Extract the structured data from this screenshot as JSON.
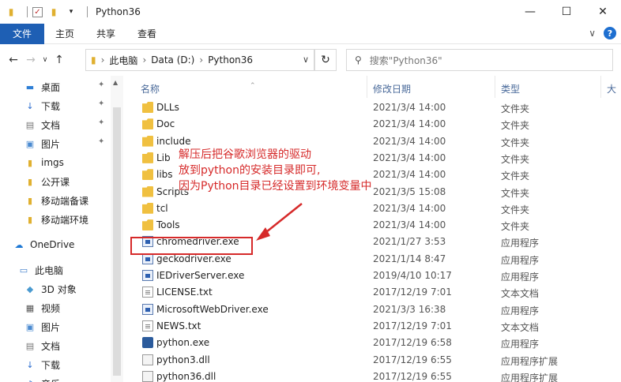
{
  "window": {
    "title": "Python36",
    "minimize_glyph": "—",
    "maximize_glyph": "☐",
    "close_glyph": "✕"
  },
  "ribbon": {
    "tabs": [
      "文件",
      "主页",
      "共享",
      "查看"
    ],
    "expand_glyph": "∨",
    "help_glyph": "?"
  },
  "address": {
    "crumbs": [
      "此电脑",
      "Data (D:)",
      "Python36"
    ],
    "search_placeholder": "搜索\"Python36\""
  },
  "sidebar": {
    "items": [
      {
        "label": "桌面",
        "icon": "desktop-icon",
        "pinned": true
      },
      {
        "label": "下载",
        "icon": "download-icon",
        "pinned": true
      },
      {
        "label": "文档",
        "icon": "document-icon",
        "pinned": true
      },
      {
        "label": "图片",
        "icon": "picture-icon",
        "pinned": true
      },
      {
        "label": "imgs",
        "icon": "folder-icon",
        "pinned": false
      },
      {
        "label": "公开课",
        "icon": "folder-icon",
        "pinned": false
      },
      {
        "label": "移动端备课",
        "icon": "folder-icon",
        "pinned": false
      },
      {
        "label": "移动端环境",
        "icon": "folder-icon",
        "pinned": false
      },
      {
        "label": "OneDrive",
        "icon": "cloud-icon",
        "pinned": false
      },
      {
        "label": "此电脑",
        "icon": "computer-icon",
        "pinned": false
      },
      {
        "label": "3D 对象",
        "icon": "cube-icon",
        "pinned": false
      },
      {
        "label": "视频",
        "icon": "video-icon",
        "pinned": false
      },
      {
        "label": "图片",
        "icon": "picture-icon",
        "pinned": false
      },
      {
        "label": "文档",
        "icon": "document-icon",
        "pinned": false
      },
      {
        "label": "下载",
        "icon": "download-icon",
        "pinned": false
      },
      {
        "label": "音乐",
        "icon": "music-icon",
        "pinned": false
      }
    ]
  },
  "columns": {
    "name": "名称",
    "date": "修改日期",
    "type": "类型",
    "size": "大"
  },
  "files": [
    {
      "name": "DLLs",
      "date": "2021/3/4 14:00",
      "type": "文件夹",
      "kind": "folder"
    },
    {
      "name": "Doc",
      "date": "2021/3/4 14:00",
      "type": "文件夹",
      "kind": "folder"
    },
    {
      "name": "include",
      "date": "2021/3/4 14:00",
      "type": "文件夹",
      "kind": "folder"
    },
    {
      "name": "Lib",
      "date": "2021/3/4 14:00",
      "type": "文件夹",
      "kind": "folder"
    },
    {
      "name": "libs",
      "date": "2021/3/4 14:00",
      "type": "文件夹",
      "kind": "folder"
    },
    {
      "name": "Scripts",
      "date": "2021/3/5 15:08",
      "type": "文件夹",
      "kind": "folder"
    },
    {
      "name": "tcl",
      "date": "2021/3/4 14:00",
      "type": "文件夹",
      "kind": "folder"
    },
    {
      "name": "Tools",
      "date": "2021/3/4 14:00",
      "type": "文件夹",
      "kind": "folder"
    },
    {
      "name": "chromedriver.exe",
      "date": "2021/1/27 3:53",
      "type": "应用程序",
      "kind": "exe"
    },
    {
      "name": "geckodriver.exe",
      "date": "2021/1/14 8:47",
      "type": "应用程序",
      "kind": "exe"
    },
    {
      "name": "IEDriverServer.exe",
      "date": "2019/4/10 10:17",
      "type": "应用程序",
      "kind": "exe"
    },
    {
      "name": "LICENSE.txt",
      "date": "2017/12/19 7:01",
      "type": "文本文档",
      "kind": "txt"
    },
    {
      "name": "MicrosoftWebDriver.exe",
      "date": "2021/3/3 16:38",
      "type": "应用程序",
      "kind": "exe"
    },
    {
      "name": "NEWS.txt",
      "date": "2017/12/19 7:01",
      "type": "文本文档",
      "kind": "txt"
    },
    {
      "name": "python.exe",
      "date": "2017/12/19 6:58",
      "type": "应用程序",
      "kind": "pyexe"
    },
    {
      "name": "python3.dll",
      "date": "2017/12/19 6:55",
      "type": "应用程序扩展",
      "kind": "dll"
    },
    {
      "name": "python36.dll",
      "date": "2017/12/19 6:55",
      "type": "应用程序扩展",
      "kind": "dll"
    }
  ],
  "annotation": {
    "lines": [
      "解压后把谷歌浏览器的驱动",
      "放到python的安装目录即可,",
      "因为Python目录已经设置到环境变量中"
    ],
    "color": "#d62a2a"
  }
}
